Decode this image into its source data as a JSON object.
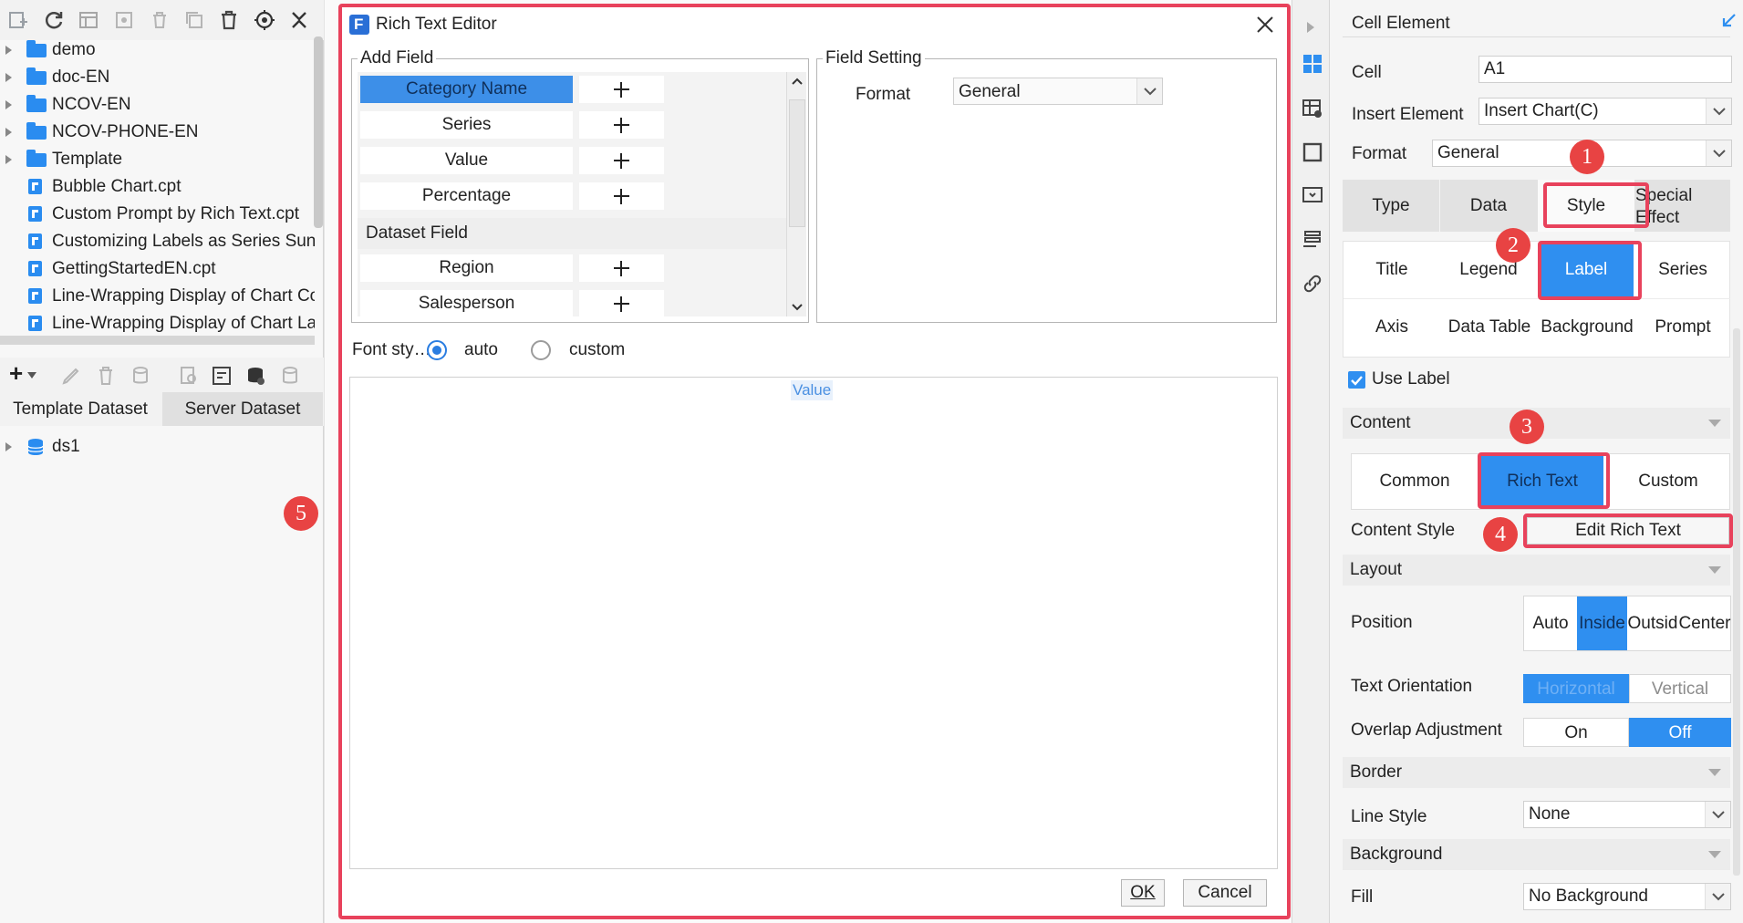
{
  "file_tree": {
    "items": [
      {
        "label": "demo",
        "kind": "folder"
      },
      {
        "label": "doc-EN",
        "kind": "folder"
      },
      {
        "label": "NCOV-EN",
        "kind": "folder"
      },
      {
        "label": "NCOV-PHONE-EN",
        "kind": "folder"
      },
      {
        "label": "Template",
        "kind": "folder"
      },
      {
        "label": "Bubble Chart.cpt",
        "kind": "file"
      },
      {
        "label": "Custom Prompt by Rich Text.cpt",
        "kind": "file"
      },
      {
        "label": "Customizing Labels as Series Sun",
        "kind": "file"
      },
      {
        "label": "GettingStartedEN.cpt",
        "kind": "file"
      },
      {
        "label": "Line-Wrapping Display of Chart Co",
        "kind": "file"
      },
      {
        "label": "Line-Wrapping Display of Chart Lal",
        "kind": "file"
      }
    ]
  },
  "dataset_panel": {
    "tabs": [
      "Template Dataset",
      "Server Dataset"
    ],
    "active_tab": 1,
    "items": [
      "ds1"
    ],
    "add_symbol": "+"
  },
  "dialog": {
    "title": "Rich Text Editor",
    "add_field": {
      "label": "Add Field",
      "fields": [
        "Category Name",
        "Series",
        "Value",
        "Percentage"
      ],
      "selected": "Category Name",
      "dataset_section": "Dataset Field",
      "dataset_fields": [
        "Region",
        "Salesperson"
      ]
    },
    "field_setting": {
      "label": "Field Setting",
      "format_label": "Format",
      "format_value": "General"
    },
    "font_style": {
      "label": "Font sty…",
      "options": [
        "auto",
        "custom"
      ],
      "selected": "auto"
    },
    "editor_chip": "Value",
    "ok": "OK",
    "cancel": "Cancel"
  },
  "properties": {
    "header": "Cell Element",
    "cell_label": "Cell",
    "cell_value": "A1",
    "insert_label": "Insert Element",
    "insert_value": "Insert Chart(C)",
    "format_label": "Format",
    "format_value": "General",
    "main_tabs": [
      "Type",
      "Data",
      "Style",
      "Special Effect"
    ],
    "main_tab_active": "Style",
    "style_tabs_row1": [
      "Title",
      "Legend",
      "Label",
      "Series"
    ],
    "style_tabs_row2": [
      "Axis",
      "Data Table",
      "Background",
      "Prompt"
    ],
    "style_tab_active": "Label",
    "use_label": "Use Label",
    "use_label_checked": true,
    "content_section": "Content",
    "content_options": [
      "Common",
      "Rich Text",
      "Custom"
    ],
    "content_active": "Rich Text",
    "content_style_label": "Content Style",
    "edit_rich_text": "Edit Rich Text",
    "layout_section": "Layout",
    "position_label": "Position",
    "position_options": [
      "Auto",
      "Inside",
      "Outsid",
      "Center"
    ],
    "position_active": "Inside",
    "text_orientation_label": "Text Orientation",
    "orientation_options": [
      "Horizontal",
      "Vertical"
    ],
    "orientation_active": "Horizontal",
    "overlap_label": "Overlap Adjustment",
    "overlap_options": [
      "On",
      "Off"
    ],
    "overlap_active": "Off",
    "border_section": "Border",
    "line_style_label": "Line Style",
    "line_style_value": "None",
    "background_section": "Background",
    "fill_label": "Fill",
    "fill_value": "No Background"
  },
  "annotations": {
    "badges": [
      "1",
      "2",
      "3",
      "4",
      "5"
    ],
    "highlight_color": "#e8425c",
    "badge_color": "#e84343",
    "accent_color": "#2f8ff0"
  }
}
